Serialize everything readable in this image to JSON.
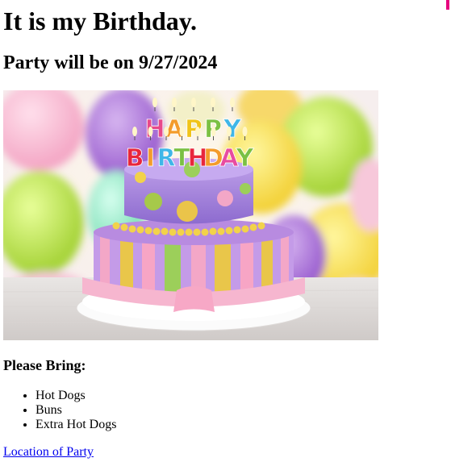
{
  "heading": "It is my Birthday.",
  "subheading": "Party will be on 9/27/2024",
  "image": {
    "alt": "Birthday cake with Happy Birthday candles"
  },
  "cake": {
    "candles_top": [
      "H",
      "A",
      "P",
      "P",
      "Y"
    ],
    "candles_bottom": [
      "B",
      "I",
      "R",
      "T",
      "H",
      "D",
      "A",
      "Y"
    ],
    "candle_colors_top": [
      "#e8488a",
      "#f39c2b",
      "#f0c419",
      "#7bc043",
      "#3fb6e8"
    ],
    "candle_colors_bottom": [
      "#e8263c",
      "#f39c2b",
      "#3fb6e8",
      "#7bc043",
      "#e8263c",
      "#f39c2b",
      "#e84ca0",
      "#7bc043"
    ]
  },
  "bring_label": "Please Bring:",
  "items": [
    "Hot Dogs",
    "Buns",
    "Extra Hot Dogs"
  ],
  "location_link": "Location of Party",
  "colors": {
    "accent_mark": "#e6007e",
    "link": "#0000ee"
  }
}
